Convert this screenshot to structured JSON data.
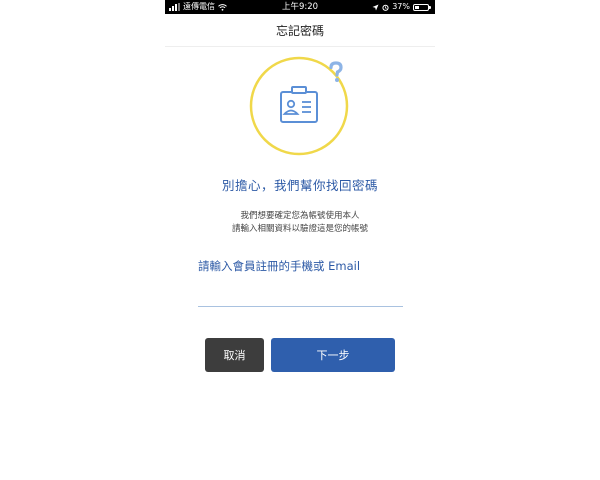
{
  "status_bar": {
    "carrier": "遠傳電信",
    "time": "上午9:20",
    "battery_text": "37%",
    "battery_level": 0.37,
    "icons": [
      "signal-icon",
      "wifi-icon",
      "location-icon",
      "alarm-icon",
      "battery-icon"
    ]
  },
  "nav": {
    "title": "忘記密碼"
  },
  "hero": {
    "icon": "id-badge-question-icon",
    "ring_color": "#f0d84a",
    "badge_color": "#5b8fd6",
    "question_color": "#8db4e6"
  },
  "content": {
    "heading": "別擔心，我們幫你找回密碼",
    "desc_line1": "我們想要確定您為帳號使用本人",
    "desc_line2": "請輸入相關資料以驗證這是您的帳號"
  },
  "form": {
    "label": "請輸入會員註冊的手機或 Email",
    "value": "",
    "placeholder": ""
  },
  "buttons": {
    "cancel_label": "取消",
    "next_label": "下一步"
  },
  "colors": {
    "accent": "#2d5aa6",
    "button_primary": "#2f5fad",
    "button_secondary": "#3d3d3d"
  }
}
